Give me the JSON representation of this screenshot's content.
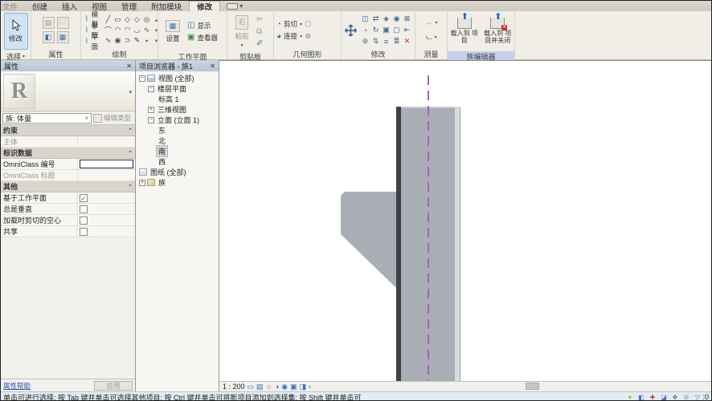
{
  "tabs": {
    "items": [
      {
        "name": "tab-file",
        "label": "文件",
        "muted": true,
        "active": false
      },
      {
        "name": "tab-create",
        "label": "创建",
        "muted": false,
        "active": false
      },
      {
        "name": "tab-insert",
        "label": "插入",
        "muted": false,
        "active": false
      },
      {
        "name": "tab-view",
        "label": "视图",
        "muted": false,
        "active": false
      },
      {
        "name": "tab-manage",
        "label": "管理",
        "muted": false,
        "active": false
      },
      {
        "name": "tab-addins",
        "label": "附加模块",
        "muted": false,
        "active": false
      },
      {
        "name": "tab-modify",
        "label": "修改",
        "muted": false,
        "active": true
      }
    ],
    "overflow_dropdown_glyph": "▾"
  },
  "ribbon": {
    "select": {
      "label": "选择",
      "dropdown_glyph": "▾",
      "modify_button_label": "修改"
    },
    "properties": {
      "label": "属性"
    },
    "draw": {
      "label": "绘制",
      "row_labels": [
        "模型",
        "参照",
        "平面"
      ],
      "grid": [
        [
          "╱",
          "▭",
          "◇",
          "◇",
          "◎",
          "▴"
        ],
        [
          "⌒",
          "◠",
          "◠",
          "◡",
          "∿",
          "▾"
        ],
        [
          "∿",
          "◉",
          "⊃",
          "✎",
          "•",
          "▾"
        ]
      ]
    },
    "work_plane": {
      "label": "工作平面",
      "set_label": "设置",
      "show_label": "显示",
      "viewer_label": "查看器"
    },
    "clipboard": {
      "label": "剪贴板",
      "paste_label": "粘贴",
      "dropdown_glyph": "▾"
    },
    "geometry": {
      "label": "几何图形",
      "cut_label": "剪切",
      "join_label": "连接",
      "dropdown_glyph": "▾"
    },
    "modify": {
      "label": "修改",
      "grid": [
        [
          "◫",
          "⇄",
          "◈",
          "◉",
          "⊠"
        ],
        [
          "◔",
          "↻",
          "▣",
          "▢",
          "⇤"
        ],
        [
          "⊚",
          "⇅",
          "≡",
          "≣",
          "✕"
        ]
      ]
    },
    "measure": {
      "label": "测量",
      "dropdown_glyph": "▾"
    },
    "family_editor": {
      "label": "族编辑器",
      "highlight_color": "#c9cdee",
      "load_label": "载入到 项目",
      "load_close_label": "载入到 项目并关闭"
    }
  },
  "properties_palette": {
    "title": "属性",
    "close_glyph": "✕",
    "preview_letter": "R",
    "preview_dropdown_glyph": "▾",
    "family_row": {
      "selector_label": "族: 体量",
      "dropdown_glyph": "∨",
      "edit_type_label": "编辑类型"
    },
    "sections": [
      {
        "header": "约束",
        "rows": [
          {
            "label": "主体",
            "muted": true,
            "value": "",
            "type": "text"
          }
        ]
      },
      {
        "header": "标识数据",
        "rows": [
          {
            "label": "OmniClass 编号",
            "muted": false,
            "value": "",
            "type": "focused-input"
          },
          {
            "label": "OmniClass 标题",
            "muted": true,
            "value": "",
            "type": "text"
          }
        ]
      },
      {
        "header": "其他",
        "rows": [
          {
            "label": "基于工作平面",
            "muted": false,
            "type": "checkbox",
            "checked": true
          },
          {
            "label": "总是垂直",
            "muted": false,
            "type": "checkbox",
            "checked": false
          },
          {
            "label": "加载时剪切的空心",
            "muted": false,
            "type": "checkbox",
            "checked": false
          },
          {
            "label": "共享",
            "muted": false,
            "type": "checkbox",
            "checked": false
          }
        ]
      }
    ],
    "collapse_glyph": "⌃",
    "help_link": "属性帮助",
    "apply_label": "应用"
  },
  "browser": {
    "title": "项目浏览器 - 族1",
    "close_glyph": "✕",
    "tree": [
      {
        "name": "tree-item-views",
        "label": "视图 (全部)",
        "depth": 0,
        "expander": "minus",
        "icon": "views",
        "selected": false
      },
      {
        "name": "tree-item-floor-plans",
        "label": "楼层平面",
        "depth": 1,
        "expander": "minus",
        "icon": "",
        "selected": false
      },
      {
        "name": "tree-item-level-1",
        "label": "标高 1",
        "depth": 2,
        "expander": "",
        "icon": "",
        "selected": false
      },
      {
        "name": "tree-item-3d-views",
        "label": "三维视图",
        "depth": 1,
        "expander": "plus",
        "icon": "",
        "selected": false
      },
      {
        "name": "tree-item-elevations",
        "label": "立面 (立面 1)",
        "depth": 1,
        "expander": "minus",
        "icon": "",
        "selected": false
      },
      {
        "name": "tree-item-east",
        "label": "东",
        "depth": 2,
        "expander": "",
        "icon": "",
        "selected": false
      },
      {
        "name": "tree-item-north",
        "label": "北",
        "depth": 2,
        "expander": "",
        "icon": "",
        "selected": false
      },
      {
        "name": "tree-item-south",
        "label": "南",
        "depth": 2,
        "expander": "",
        "icon": "",
        "selected": true
      },
      {
        "name": "tree-item-west",
        "label": "西",
        "depth": 2,
        "expander": "",
        "icon": "",
        "selected": false
      },
      {
        "name": "tree-item-sheets",
        "label": "图纸 (全部)",
        "depth": 0,
        "expander": "",
        "icon": "sheets",
        "selected": false
      },
      {
        "name": "tree-item-families",
        "label": "族",
        "depth": 0,
        "expander": "plus",
        "icon": "fam",
        "selected": false
      }
    ]
  },
  "canvas": {
    "scale_label": "1 : 200",
    "collapse_glyph": "‹",
    "view_icons": [
      {
        "name": "detail-level-icon",
        "glyph": "▭",
        "warm": false
      },
      {
        "name": "visual-style-icon",
        "glyph": "▤",
        "warm": false
      },
      {
        "name": "sun-path-icon",
        "glyph": "☼",
        "warm": true
      },
      {
        "name": "shadows-icon",
        "glyph": "◑",
        "warm": false
      },
      {
        "name": "temporary-hide-icon",
        "glyph": "◉",
        "warm": false
      },
      {
        "name": "crop-view-icon",
        "glyph": "▣",
        "warm": false
      },
      {
        "name": "crop-region-icon",
        "glyph": "◨",
        "warm": false
      }
    ],
    "mass_color": "#a9aeb6",
    "mass_edge_color": "#3e4246",
    "mass_highlight_color": "#d8dcdf",
    "centerline_color": "#a264b2"
  },
  "statusbar": {
    "message": "单击可进行选择; 按 Tab 键并单击可选择其他项目; 按 Ctrl 键并单击可将新项目添加到选择集; 按 Shift 键并单击可",
    "icons": [
      {
        "name": "worksharing-icon",
        "glyph": "✦",
        "color": "#c89b28"
      },
      {
        "name": "editing-requests-icon",
        "glyph": "◧",
        "color": "#4a76a8"
      },
      {
        "name": "pin-icon",
        "glyph": "✚",
        "color": "#c04038"
      },
      {
        "name": "design-options-icon",
        "glyph": "◪",
        "color": "#4a76a8"
      },
      {
        "name": "drag-elements-icon",
        "glyph": "✥",
        "color": "#6a6a6a"
      },
      {
        "name": "gear-icon",
        "glyph": "⚙",
        "color": "#9a9a9a"
      },
      {
        "name": "filter-icon",
        "glyph": "▽",
        "color": "#4a76a8"
      }
    ],
    "selection_count": ":0"
  }
}
